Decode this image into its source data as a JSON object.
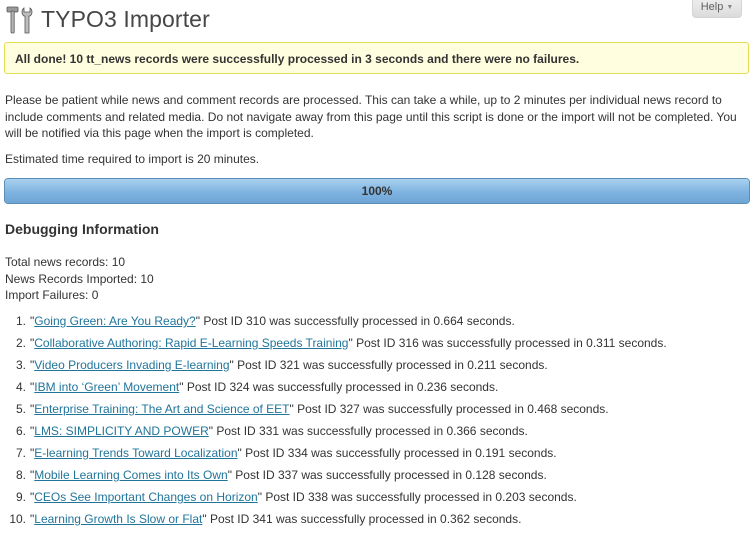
{
  "header": {
    "title": "TYPO3 Importer",
    "help_label": "Help",
    "help_arrow": "▼"
  },
  "notice": {
    "text": "All done! 10 tt_news records were successfully processed in 3 seconds and there were no failures."
  },
  "intro": {
    "text": "Please be patient while news and comment records are processed. This can take a while, up to 2 minutes per individual news record to include comments and related media. Do not navigate away from this page until this script is done or the import will not be completed. You will be notified via this page when the import is completed."
  },
  "estimate": {
    "text": "Estimated time required to import is 20 minutes."
  },
  "progress": {
    "label": "100%",
    "percent": 100
  },
  "debug": {
    "heading": "Debugging Information",
    "total": "Total news records: 10",
    "imported": "News Records Imported: 10",
    "failures": "Import Failures: 0"
  },
  "records": [
    {
      "num": "1.",
      "title": "Going Green: Are You Ready?",
      "rest": " Post ID 310 was successfully processed in 0.664 seconds."
    },
    {
      "num": "2.",
      "title": "Collaborative Authoring: Rapid E-Learning Speeds Training",
      "rest": " Post ID 316 was successfully processed in 0.311 seconds."
    },
    {
      "num": "3.",
      "title": "Video Producers Invading E-learning",
      "rest": " Post ID 321 was successfully processed in 0.211 seconds."
    },
    {
      "num": "4.",
      "title": "IBM into ‘Green’ Movement",
      "rest": " Post ID 324 was successfully processed in 0.236 seconds."
    },
    {
      "num": "5.",
      "title": "Enterprise Training: The Art and Science of EET",
      "rest": " Post ID 327 was successfully processed in 0.468 seconds."
    },
    {
      "num": "6.",
      "title": "LMS: SIMPLICITY AND POWER",
      "rest": " Post ID 331 was successfully processed in 0.366 seconds."
    },
    {
      "num": "7.",
      "title": "E-learning Trends Toward Localization",
      "rest": " Post ID 334 was successfully processed in 0.191 seconds."
    },
    {
      "num": "8.",
      "title": "Mobile Learning Comes into Its Own",
      "rest": " Post ID 337 was successfully processed in 0.128 seconds."
    },
    {
      "num": "9.",
      "title": "CEOs See Important Changes on Horizon",
      "rest": " Post ID 338 was successfully processed in 0.203 seconds."
    },
    {
      "num": "10.",
      "title": "Learning Growth Is Slow or Flat",
      "rest": " Post ID 341 was successfully processed in 0.362 seconds."
    }
  ],
  "icons": {
    "title_icon": "tools-icon"
  },
  "colors": {
    "link": "#21759b",
    "notice_bg": "#ffffe0",
    "notice_border": "#e6db55",
    "progress_fill": "#7fb3e0"
  }
}
